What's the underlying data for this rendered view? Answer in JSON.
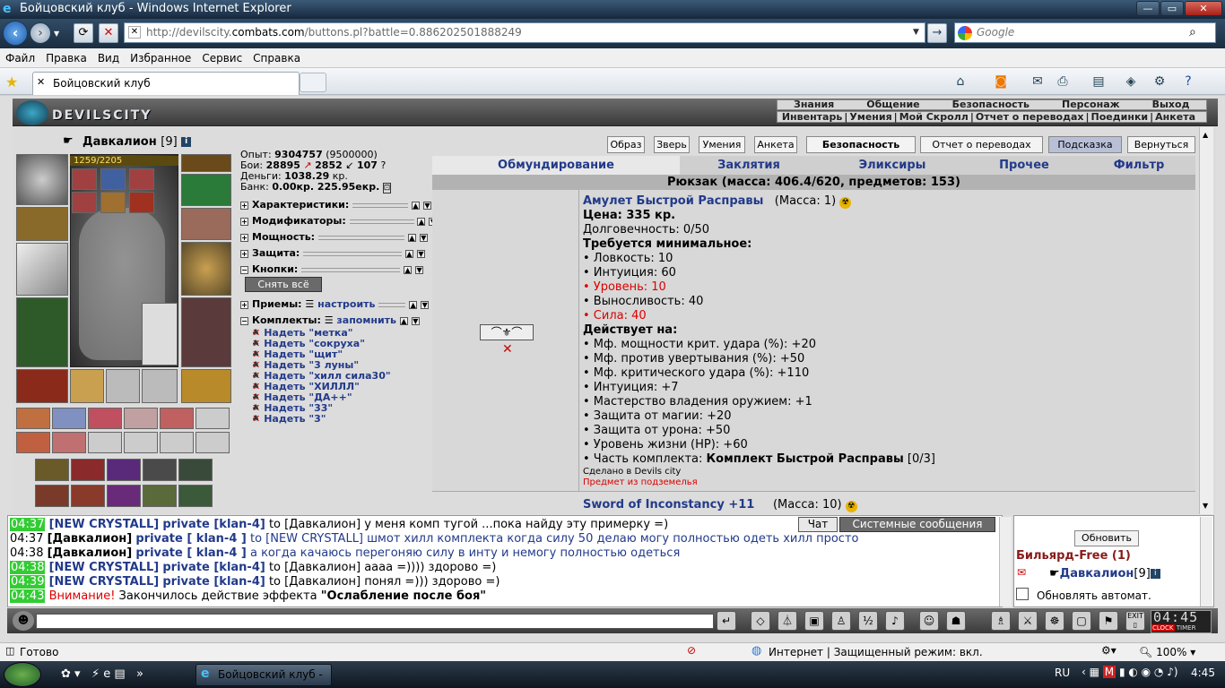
{
  "window": {
    "title": "Бойцовский клуб - Windows Internet Explorer",
    "minimize": "—",
    "maximize": "▭",
    "close": "✕"
  },
  "browser": {
    "url_prefix": "http://devilscity.",
    "url_domain": "combats.com",
    "url_rest": "/buttons.pl?battle=0.886202501888249",
    "search_placeholder": "Google",
    "menu": [
      "Файл",
      "Правка",
      "Вид",
      "Избранное",
      "Сервис",
      "Справка"
    ],
    "tab_title": "Бойцовский клуб"
  },
  "site": {
    "logo": "DEVILSCITY",
    "top_links_1": [
      "Знания",
      "Общение",
      "Безопасность",
      "Персонаж",
      "Выход"
    ],
    "top_links_2": [
      "Инвентарь",
      "Умения",
      "Мой Скролл",
      "Отчет о переводах",
      "Поединки",
      "Анкета"
    ]
  },
  "character": {
    "name": "Давкалион",
    "level": "[9]",
    "hp": "1259/2205",
    "exp_label": "Опыт:",
    "exp_value": "9304757",
    "exp_next": "(9500000)",
    "fights_label": "Бои:",
    "fights_won": "28895",
    "fights_lost": "2852",
    "fights_draw": "107",
    "money_label": "Деньги:",
    "money_value": "1038.29",
    "money_unit": "кр.",
    "bank_label": "Банк:",
    "bank_value": "0.00кр. 225.95екр."
  },
  "sections": {
    "characteristics": "Характеристики:",
    "modifiers": "Модификаторы:",
    "power": "Мощность:",
    "protection": "Защита:",
    "buttons": "Кнопки:",
    "remove_all": "Снять всё",
    "tricks": "Приемы:",
    "tricks_link": "настроить",
    "sets": "Комплекты:",
    "sets_link": "запомнить"
  },
  "sets": [
    "Надеть \"метка\"",
    "Надеть \"сокруха\"",
    "Надеть \"щит\"",
    "Надеть \"3 луны\"",
    "Надеть \"хилл сила30\"",
    "Надеть \"ХИЛЛЛ\"",
    "Надеть \"ДА++\"",
    "Надеть \"33\"",
    "Надеть \"3\""
  ],
  "top_buttons": [
    "Образ",
    "Зверь",
    "Умения",
    "Анкета",
    "Безопасность",
    "Отчет о переводах",
    "Подсказка",
    "Вернуться"
  ],
  "inventory_tabs": [
    "Обмундирование",
    "Заклятия",
    "Эликсиры",
    "Прочее",
    "Фильтр"
  ],
  "backpack": "Рюкзак (масса: 406.4/620, предметов: 153)",
  "item": {
    "name": "Амулет Быстрой Расправы",
    "mass": "(Масса: 1)",
    "price": "Цена: 335 кр.",
    "durability": "Долговечность: 0/50",
    "req_title": "Требуется минимальное:",
    "req": [
      {
        "text": "• Ловкость: 10",
        "red": false
      },
      {
        "text": "• Интуиция: 60",
        "red": false
      },
      {
        "text": "• Уровень: 10",
        "red": true
      },
      {
        "text": "• Выносливость: 40",
        "red": false
      },
      {
        "text": "• Сила: 40",
        "red": true
      }
    ],
    "acts_title": "Действует на:",
    "acts": [
      "• Мф. мощности крит. удара (%): +20",
      "• Мф. против увертывания (%): +50",
      "• Мф. критического удара (%): +110",
      "• Интуиция: +7",
      "• Мастерство владения оружием: +1",
      "• Защита от магии: +20",
      "• Защита от урона: +50",
      "• Уровень жизни (HP): +60"
    ],
    "set_prefix": "• Часть комплекта: ",
    "set_name": "Комплект Быстрой Расправы",
    "set_count": "[0/3]",
    "made_in": "Сделано в Devils city",
    "dungeon": "Предмет из подземелья"
  },
  "item2": {
    "name": "Sword of Inconstancy +11",
    "mass": "(Масса: 10)"
  },
  "chat": {
    "tab_chat": "Чат",
    "tab_system": "Системные сообщения",
    "lines": [
      {
        "time": "04:37",
        "who": "[NEW CRYSTALL]",
        "priv": "private [klan-4]",
        "to": " to [Давкалион] ",
        "msg": "у меня комп тугой ...пока найду эту примерку =)"
      },
      {
        "time": "04:37",
        "who": "[Давкалион]",
        "priv": "private [ klan-4 ]",
        "to": " to [NEW CRYSTALL] ",
        "msg": "шмот хилл комплекта когда силу 50 делаю могу полностью одеть хилл просто"
      },
      {
        "time": "04:38",
        "who": "[Давкалион]",
        "priv": "private [ klan-4 ]",
        "to": " ",
        "msg": "а когда качаюсь перегоняю силу в инту и немогу полностью одеться"
      },
      {
        "time": "04:38",
        "who": "[NEW CRYSTALL]",
        "priv": "private [klan-4]",
        "to": " to [Давкалион] ",
        "msg": "аааа =)))) здорово =)"
      },
      {
        "time": "04:39",
        "who": "[NEW CRYSTALL]",
        "priv": "private [klan-4]",
        "to": " to [Давкалион] ",
        "msg": "понял =))) здорово =)"
      }
    ],
    "system_time": "04:43",
    "system_warn": "Внимание!",
    "system_msg": " Закончилось действие эффекта ",
    "system_effect": "\"Ослабление после боя\""
  },
  "room": {
    "refresh": "Обновить",
    "name": "Бильярд-Free (1)",
    "user": "Давкалион",
    "user_level": "[9]",
    "auto_refresh": "Обновлять автомат."
  },
  "clock": {
    "time": "04:45",
    "clock_label": "CLOCK",
    "timer_label": "TIMER"
  },
  "status": {
    "ready": "Готово",
    "zone": "Интернет | Защищенный режим: вкл.",
    "zoom": "100%"
  },
  "taskbar": {
    "task": "Бойцовский клуб - ...",
    "lang": "RU",
    "time": "4:45"
  },
  "colors": {
    "link_blue": "#223a8a",
    "warning_red": "#dd0000",
    "timestamp_green": "#33cc33"
  }
}
